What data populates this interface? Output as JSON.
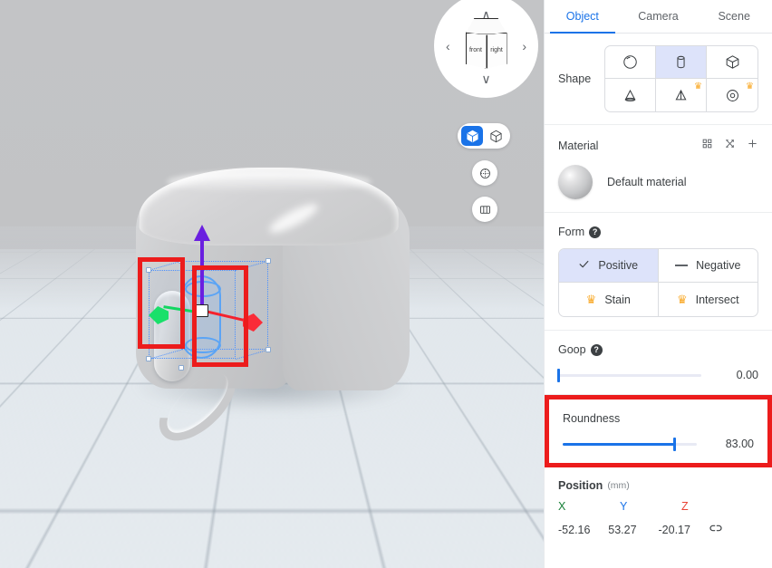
{
  "viewport": {
    "navcube": {
      "face_front_label": "front",
      "face_right_label": "right",
      "chevron_up": "∧",
      "chevron_down": "∨",
      "chevron_left": "‹",
      "chevron_right": "›"
    },
    "toolbar": {
      "items": [
        {
          "name": "solid-cube-icon",
          "active": true
        },
        {
          "name": "wireframe-cube-icon",
          "active": false
        },
        {
          "name": "orbit-sphere-icon",
          "active": false
        },
        {
          "name": "columns-grid-icon",
          "active": false
        }
      ]
    },
    "gizmo": {
      "axis_x_color": "#19e06a",
      "axis_y_color": "#6a1fe0",
      "axis_z_color": "#fa2c38",
      "selection_color": "#4a90ff"
    },
    "annotations": {
      "color": "#ec1c1c",
      "boxes": [
        {
          "label": "emboss-region-highlight"
        },
        {
          "label": "selected-cylinder-highlight"
        }
      ]
    }
  },
  "panel": {
    "tabs": [
      {
        "label": "Object",
        "active": true
      },
      {
        "label": "Camera",
        "active": false
      },
      {
        "label": "Scene",
        "active": false
      }
    ],
    "shape": {
      "label": "Shape",
      "options": [
        {
          "name": "sphere",
          "selected": false,
          "pro": false
        },
        {
          "name": "cylinder",
          "selected": true,
          "pro": false
        },
        {
          "name": "cube",
          "selected": false,
          "pro": false
        },
        {
          "name": "cone",
          "selected": false,
          "pro": false
        },
        {
          "name": "pyramid",
          "selected": false,
          "pro": true
        },
        {
          "name": "torus",
          "selected": false,
          "pro": true
        }
      ],
      "pro_badge": "♛"
    },
    "material": {
      "label": "Material",
      "name": "Default material",
      "actions": [
        {
          "name": "grid-icon"
        },
        {
          "name": "shuffle-icon"
        },
        {
          "name": "plus-icon"
        }
      ]
    },
    "form": {
      "label": "Form",
      "help": "?",
      "options": [
        {
          "label": "Positive",
          "icon": "check-icon",
          "selected": true,
          "pro": false
        },
        {
          "label": "Negative",
          "icon": "dash-icon",
          "selected": false,
          "pro": false
        },
        {
          "label": "Stain",
          "icon": "crown-icon",
          "selected": false,
          "pro": true
        },
        {
          "label": "Intersect",
          "icon": "crown-icon",
          "selected": false,
          "pro": true
        }
      ]
    },
    "goop": {
      "label": "Goop",
      "help": "?",
      "value": "0.00",
      "percent": 0
    },
    "roundness": {
      "label": "Roundness",
      "value": "83.00",
      "percent": 83,
      "highlighted": true
    },
    "position": {
      "label": "Position",
      "unit": "(mm)",
      "axes": [
        "X",
        "Y",
        "Z"
      ],
      "values": [
        "-52.16",
        "53.27",
        "-20.17"
      ],
      "link_icon": "unlink-icon"
    }
  }
}
